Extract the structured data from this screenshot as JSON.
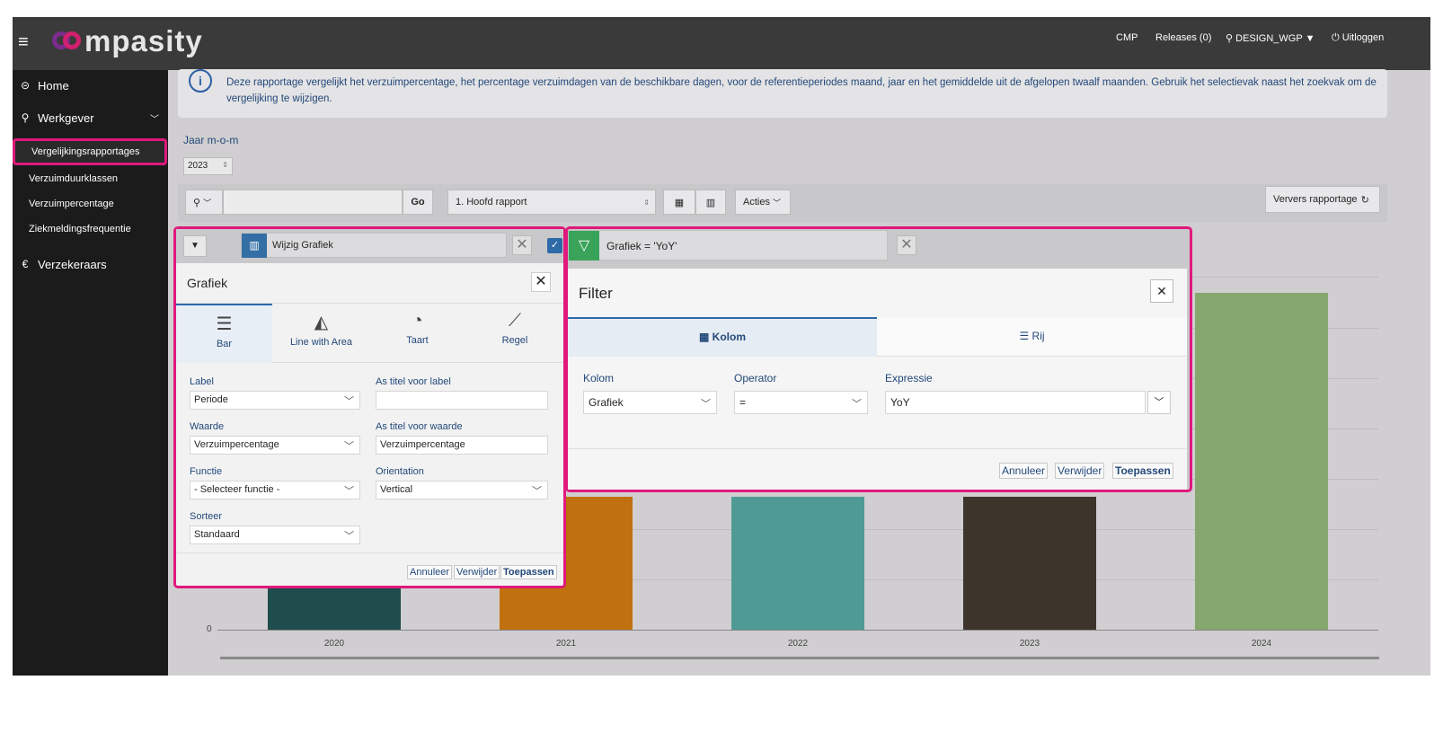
{
  "header": {
    "logo_text": "mpasity",
    "nav": {
      "cmp": "CMP",
      "releases": "Releases (0)",
      "user": "DESIGN_WGP",
      "logout": "Uitloggen"
    }
  },
  "sidebar": {
    "home": "Home",
    "employer": "Werkgever",
    "items": [
      "Vergelijkingsrapportages",
      "Verzuimduurklassen",
      "Verzuimpercentage",
      "Ziekmeldingsfrequentie"
    ],
    "insurers": "Verzekeraars"
  },
  "info": {
    "text": "Deze rapportage vergelijkt het verzuimpercentage, het percentage verzuimdagen van de beschikbare dagen, voor de referentieperiodes maand, jaar en het gemiddelde uit de afgelopen twaalf maanden. Gebruik het selectievak naast het zoekvak om de vergelijking te wijzigen."
  },
  "year": {
    "label": "Jaar m-o-m",
    "value": "2023"
  },
  "toolbar": {
    "go": "Go",
    "report": "1. Hoofd rapport",
    "actions": "Acties",
    "refresh": "Ververs rapportage"
  },
  "graph_panel": {
    "chip": "Wijzig Grafiek",
    "title": "Grafiek",
    "tabs": [
      "Bar",
      "Line with Area",
      "Taart",
      "Regel"
    ],
    "fields": {
      "label_label": "Label",
      "label_value": "Periode",
      "axis_label_label": "As titel voor label",
      "axis_label_value": "",
      "value_label": "Waarde",
      "value_value": "Verzuimpercentage",
      "axis_value_label": "As titel voor waarde",
      "axis_value_value": "Verzuimpercentage",
      "function_label": "Functie",
      "function_value": "- Selecteer functie -",
      "orientation_label": "Orientation",
      "orientation_value": "Vertical",
      "sort_label": "Sorteer",
      "sort_value": "Standaard"
    },
    "buttons": {
      "cancel": "Annuleer",
      "delete": "Verwijder",
      "apply": "Toepassen"
    }
  },
  "filter_panel": {
    "chip": "Grafiek = 'YoY'",
    "title": "Filter",
    "tabs": [
      "Kolom",
      "Rij"
    ],
    "fields": {
      "column_label": "Kolom",
      "column_value": "Grafiek",
      "operator_label": "Operator",
      "operator_value": "=",
      "expression_label": "Expressie",
      "expression_value": "YoY"
    },
    "buttons": {
      "cancel": "Annuleer",
      "delete": "Verwijder",
      "apply": "Toepassen"
    }
  },
  "chart_data": {
    "type": "bar",
    "categories": [
      "2020",
      "2021",
      "2022",
      "2023",
      "2024"
    ],
    "values": [
      null,
      null,
      null,
      null,
      null
    ],
    "colors": [
      "#1f4c4c",
      "#c0700f",
      "#4f9a95",
      "#3d352c",
      "#86a86f"
    ],
    "y_tick_visible": "0"
  }
}
